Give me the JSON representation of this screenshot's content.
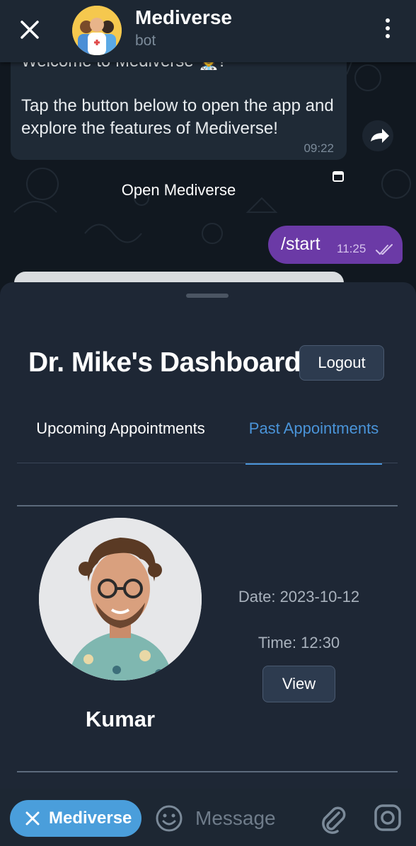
{
  "header": {
    "title": "Mediverse",
    "subtitle": "bot"
  },
  "messages": {
    "welcome_line": "Welcome to Mediverse 🧑‍⚕️!",
    "welcome_body": "Tap the button below to open the app and explore the features of Mediverse!",
    "welcome_time": "09:22",
    "open_button_label": "Open Mediverse",
    "user_command": "/start",
    "user_time": "11:25"
  },
  "dashboard": {
    "title": "Dr. Mike's Dashboard",
    "logout_label": "Logout",
    "tabs": [
      {
        "label": "Upcoming Appointments",
        "active": false
      },
      {
        "label": "Past Appointments",
        "active": true
      }
    ],
    "appointment": {
      "patient_name": "Kumar",
      "date_text": "Date: 2023-10-12",
      "time_text": "Time: 12:30",
      "view_label": "View"
    }
  },
  "input_bar": {
    "app_chip_label": "Mediverse",
    "message_placeholder": "Message"
  },
  "colors": {
    "accent": "#4a94d9",
    "user_bubble": "#6b3aa6",
    "sheet_background": "#1e2735",
    "header_background": "#1d2733"
  },
  "icons": [
    "close-icon",
    "more-vertical-icon",
    "share-icon",
    "webapp-icon",
    "double-check-icon",
    "emoji-icon",
    "paperclip-icon",
    "camera-icon"
  ]
}
